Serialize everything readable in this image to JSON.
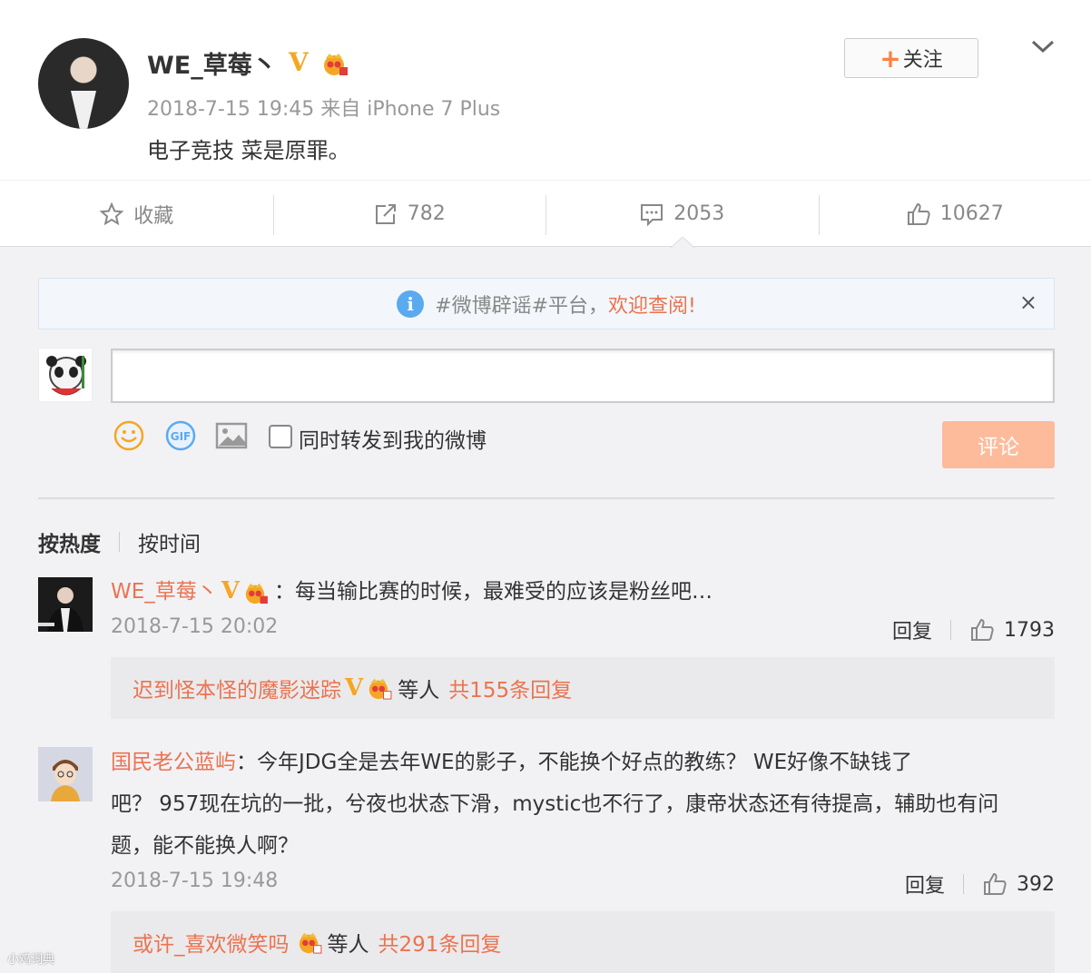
{
  "post": {
    "username": "WE_草莓丶",
    "meta": "2018-7-15 19:45 来自 iPhone 7 Plus",
    "content": "电子竞技 菜是原罪。",
    "follow_label": "关注",
    "follow_plus": "+"
  },
  "actions": {
    "favorite": "收藏",
    "repost": "782",
    "comment": "2053",
    "like": "10627"
  },
  "banner": {
    "text": "#微博辟谣#平台，",
    "welcome": "欢迎查阅!",
    "close": "×",
    "info": "i"
  },
  "composer": {
    "repost_label": "同时转发到我的微博",
    "submit": "评论",
    "gif_label": "GIF"
  },
  "sort": {
    "hot": "按热度",
    "time": "按时间"
  },
  "badges": {
    "v": "V"
  },
  "comments": [
    {
      "name": "WE_草莓丶",
      "text": "：每当输比赛的时候，最难受的应该是粉丝吧…",
      "time": "2018-7-15 20:02",
      "reply": "回复",
      "likes": "1793",
      "replies_name": "迟到怪本怪的魔影迷踪",
      "replies_mid": "等人",
      "replies_count": "共155条回复"
    },
    {
      "name": "国民老公蓝屿",
      "line1": "：今年JDG全是去年WE的影子，不能换个好点的教练？  WE好像不缺钱了",
      "line2": "吧？    957现在坑的一批，兮夜也状态下滑，mystic也不行了，康帝状态还有待提高，辅助也有问",
      "line3": "题，能不能换人啊？",
      "time": "2018-7-15 19:48",
      "reply": "回复",
      "likes": "392",
      "replies_name": "或许_喜欢微笑吗",
      "replies_mid": "等人",
      "replies_count": "共291条回复"
    }
  ],
  "watermark": "小鸡词典",
  "colors": {
    "accent": "#eb7350",
    "gold": "#f5a623",
    "submit": "#fdbb9c",
    "info": "#5aaaf0"
  }
}
